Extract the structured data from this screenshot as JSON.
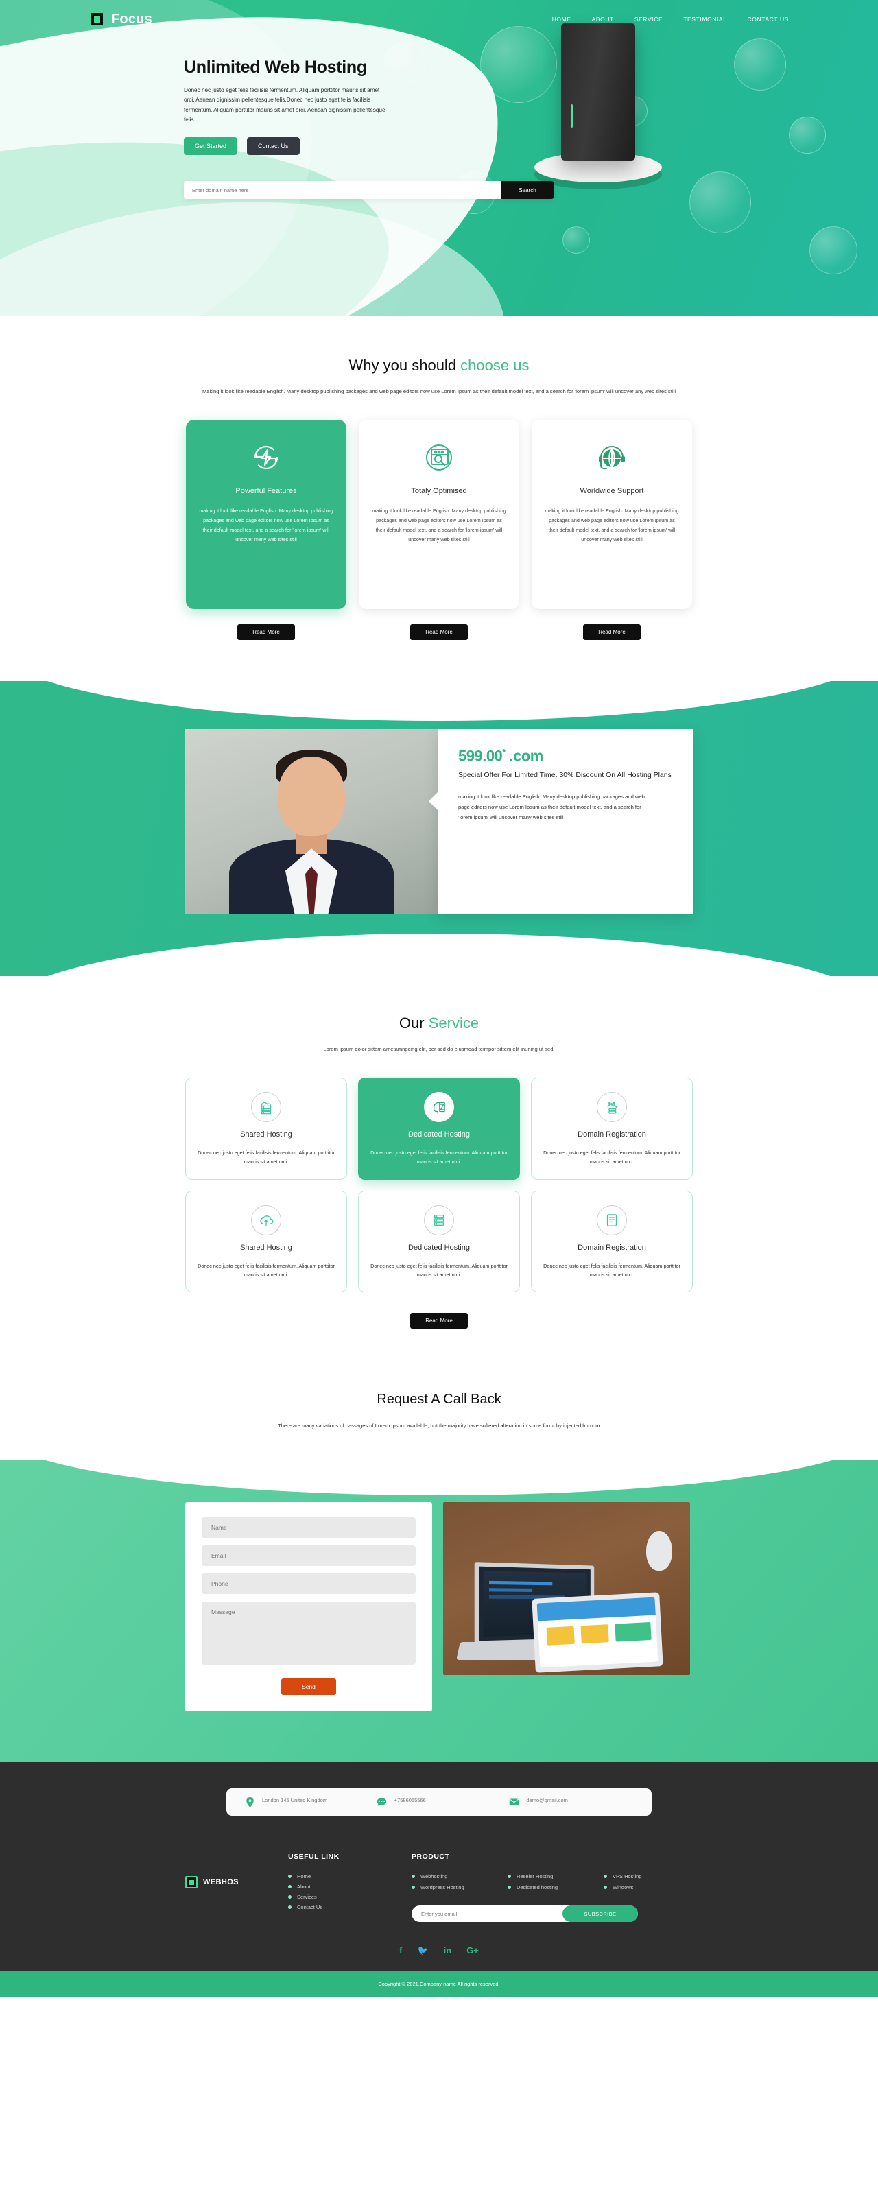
{
  "brand": {
    "name": "Focus",
    "mark_icon": "square-logo-icon"
  },
  "nav": {
    "items": [
      {
        "label": "HOME"
      },
      {
        "label": "ABOUT"
      },
      {
        "label": "SERVICE"
      },
      {
        "label": "TESTIMONIAL"
      },
      {
        "label": "CONTACT US"
      }
    ]
  },
  "hero": {
    "title": "Unlimited Web Hosting",
    "description": "Donec nec justo eget felis facilisis fermentum. Aliquam porttitor mauris sit amet orci. Aenean dignissim pellentesque felis.Donec nec justo eget felis facilisis fermentum. Aliquam porttitor mauris sit amet orci. Aenean dignissim pellentesque felis.",
    "primary_button": "Get Started",
    "secondary_button": "Contact Us",
    "search_placeholder": "Enter domain name here",
    "search_button": "Search"
  },
  "why": {
    "title_main": "Why you should ",
    "title_accent": "choose us",
    "subtitle": "Making it look like readable English. Many desktop publishing packages and web page editors now use Lorem Ipsum as their default model text, and a search for 'lorem ipsum' will uncover any web sites still",
    "cards": [
      {
        "icon": "power-refresh-icon",
        "title": "Powerful Features",
        "body": "making it look like readable English. Many desktop publishing packages and web page editors now use Lorem Ipsum as their default model text, and a search for 'lorem ipsum' will uncover many web sites still",
        "button": "Read More"
      },
      {
        "icon": "browser-search-icon",
        "title": "Totaly Optimised",
        "body": "making it look like readable English. Many desktop publishing packages and web page editors now use Lorem Ipsum as their default model text, and a search for 'lorem ipsum' will uncover many web sites still",
        "button": "Read More"
      },
      {
        "icon": "globe-headset-icon",
        "title": "Worldwide Support",
        "body": "making it look like readable English. Many desktop publishing packages and web page editors now use Lorem Ipsum as their default model text, and a search for 'lorem ipsum' will uncover many web sites still",
        "button": "Read More"
      }
    ]
  },
  "promo": {
    "price": "599.00",
    "price_sup": "*",
    "tld": ".com",
    "heading": "Special Offer For Limited Time. 30% Discount On All Hosting Plans",
    "body": "making it look like readable English. Many desktop publishing packages and web page editors now use Lorem Ipsum as their default model text, and a search for 'lorem ipsum' will uncover many web sites still",
    "photo_alt": "portrait-photo"
  },
  "services": {
    "title_main": "Our ",
    "title_accent": "Service",
    "subtitle": "Lorem ipsum dolor sittem ametamngcing elit, per sed do eiusmoad teimpor sittem elit inuning ut sed.",
    "items": [
      {
        "icon": "cloud-server-icon",
        "title": "Shared Hosting",
        "body": "Donec nec justo eget felis facilisis fermentum. Aliquam porttitor mauris sit amet orci.",
        "active": false
      },
      {
        "icon": "head-hourglass-icon",
        "title": "Dedicated Hosting",
        "body": "Donec nec justo eget felis facilisis fermentum. Aliquam porttitor mauris sit amet orci.",
        "active": true
      },
      {
        "icon": "cloud-network-icon",
        "title": "Domain Registration",
        "body": "Donec nec justo eget felis facilisis fermentum. Aliquam porttitor mauris sit amet orci.",
        "active": false
      },
      {
        "icon": "cloud-upload-icon",
        "title": "Shared Hosting",
        "body": "Donec nec justo eget felis facilisis fermentum. Aliquam porttitor mauris sit amet orci.",
        "active": false
      },
      {
        "icon": "server-rack-icon",
        "title": "Dedicated Hosting",
        "body": "Donec nec justo eget felis facilisis fermentum. Aliquam porttitor mauris sit amet orci.",
        "active": false
      },
      {
        "icon": "document-list-icon",
        "title": "Domain Registration",
        "body": "Donec nec justo eget felis facilisis fermentum. Aliquam porttitor mauris sit amet orci.",
        "active": false
      }
    ],
    "read_more": "Read More"
  },
  "callback": {
    "title": "Request A Call Back",
    "subtitle": "There are many variations of passages of Lorem Ipsum available, but the majority have suffered alteration in some form, by injected humour",
    "form": {
      "name_placeholder": "Name",
      "email_placeholder": "Email",
      "phone_placeholder": "Phone",
      "message_placeholder": "Massage",
      "send_label": "Send"
    },
    "photo_alt": "laptop-tablet-desk-photo"
  },
  "footer": {
    "contact": [
      {
        "icon": "location-pin-icon",
        "text": "London 145 United Kingdom"
      },
      {
        "icon": "telephone-icon",
        "text": "+7586055566"
      },
      {
        "icon": "envelope-icon",
        "text": "demo@gmail.com"
      }
    ],
    "logo": {
      "name": "WEBHOS",
      "mark_icon": "square-logo-icon"
    },
    "useful_link": {
      "title": "USEFUL LINK",
      "items": [
        {
          "label": "Home"
        },
        {
          "label": "About"
        },
        {
          "label": "Services"
        },
        {
          "label": "Contact Us"
        }
      ]
    },
    "product": {
      "title": "PRODUCT",
      "items": [
        {
          "label": "Webhosting"
        },
        {
          "label": "Reseler Hosting"
        },
        {
          "label": "VPS Hosting"
        },
        {
          "label": "Wordpress Hosting"
        },
        {
          "label": "Dedicated hosting"
        },
        {
          "label": "Windows"
        }
      ],
      "subscribe_placeholder": "Enter you email",
      "subscribe_button": "SUBSCRIBE"
    },
    "social": [
      {
        "icon": "facebook-icon",
        "glyph": "f"
      },
      {
        "icon": "twitter-icon",
        "glyph": "🐦"
      },
      {
        "icon": "linkedin-icon",
        "glyph": "in"
      },
      {
        "icon": "google-plus-icon",
        "glyph": "G+"
      }
    ],
    "copyright": "Copyright © 2021.Company name All rights reserved."
  },
  "colors": {
    "brand_green": "#2fb57f",
    "accent_green": "#3fc188",
    "dark": "#2e2e2e",
    "send_orange": "#d9480f"
  }
}
